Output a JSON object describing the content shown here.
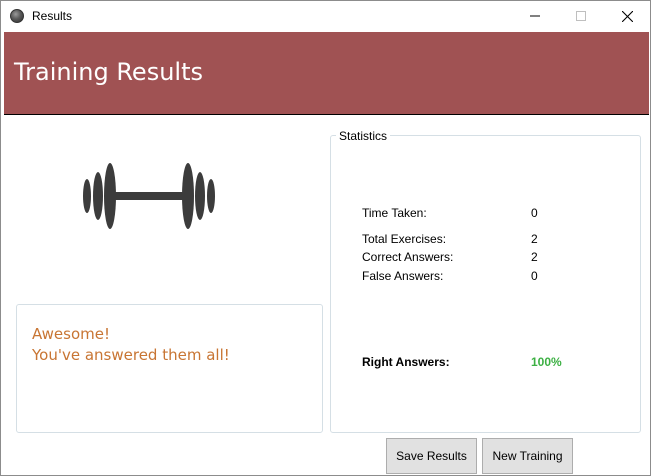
{
  "window": {
    "title": "Results",
    "app_icon": "dumbbell-app-icon",
    "controls": {
      "minimize_icon": "minimize-icon",
      "maximize_icon": "maximize-icon",
      "close_icon": "close-icon"
    }
  },
  "header": {
    "title": "Training Results",
    "background_color": "#a05253"
  },
  "illustration": {
    "icon": "dumbbell-icon",
    "color": "#3c3c3c"
  },
  "message": {
    "line1": "Awesome!",
    "line2": "You've answered them all!",
    "color": "#c87533"
  },
  "statistics": {
    "legend": "Statistics",
    "time_taken": {
      "label": "Time Taken:",
      "value": "0"
    },
    "total_exercises": {
      "label": "Total Exercises:",
      "value": "2"
    },
    "correct_answers": {
      "label": "Correct Answers:",
      "value": "2"
    },
    "false_answers": {
      "label": "False Answers:",
      "value": "0"
    },
    "right_answers": {
      "label": "Right Answers:",
      "value": "100%",
      "color": "#3cb043"
    }
  },
  "buttons": {
    "save_label": "Save Results",
    "new_label": "New Training"
  }
}
